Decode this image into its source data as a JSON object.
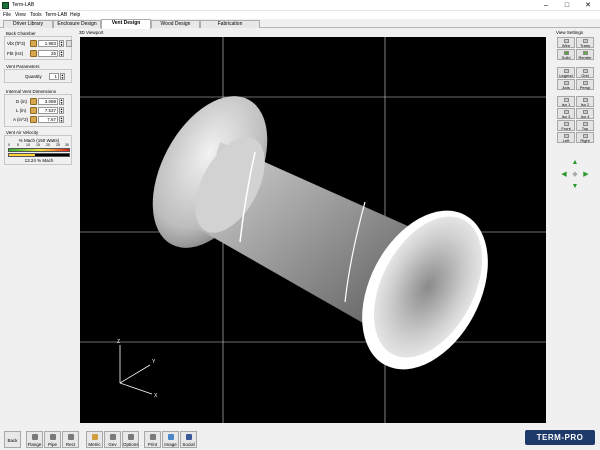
{
  "window": {
    "title": "Term-LAB"
  },
  "menu": [
    "File",
    "View",
    "Tools",
    "Term-LAB",
    "Help"
  ],
  "tabs": [
    {
      "label": "Driver Library"
    },
    {
      "label": "Enclosure Design"
    },
    {
      "label": "Vent Design",
      "active": true
    },
    {
      "label": "Wood Design"
    },
    {
      "label": "Fabrication"
    }
  ],
  "back_chamber": {
    "title": "Back Chamber",
    "vbt": {
      "label": "Vbt (ft^3)",
      "value": "1.983"
    },
    "fbt": {
      "label": "Fbt (Hz)",
      "value": "26"
    }
  },
  "vent_parameters": {
    "title": "Vent Parameters",
    "quantity": {
      "label": "Quantity",
      "value": "1"
    }
  },
  "internal_vent": {
    "title": "Internal Vent Dimensions",
    "d": {
      "label": "D (in)",
      "value": "3.089"
    },
    "l": {
      "label": "L (in)",
      "value": "7.537"
    },
    "a": {
      "label": "A (in^2)",
      "value": "7.67"
    }
  },
  "air_velocity": {
    "title": "Vent Air Velocity",
    "subtitle": "% Mach (150 Watts)",
    "ticks": [
      "0",
      "5",
      "10",
      "15",
      "20",
      "25",
      "30"
    ],
    "value": "13.24 % Mach",
    "fraction": 0.44
  },
  "viewport": {
    "label": "3D Viewport"
  },
  "view_settings": {
    "title": "View Settings",
    "buttons": [
      "Wire",
      "Trans",
      "Solid",
      "Render",
      "Legend",
      "Grid",
      "Axis",
      "Persp",
      "Iso 1",
      "Iso 2",
      "Iso 3",
      "Iso 4",
      "Front",
      "Top",
      "Left",
      "Right"
    ]
  },
  "bottom": {
    "buttons": [
      "Back",
      "Flange",
      "Pipe",
      "Rect",
      "Metric",
      "Gev",
      "Options",
      "Print",
      "Image",
      "Social"
    ],
    "brand": "TERM-PRO"
  },
  "axes": {
    "x": "X",
    "y": "Y",
    "z": "Z"
  }
}
